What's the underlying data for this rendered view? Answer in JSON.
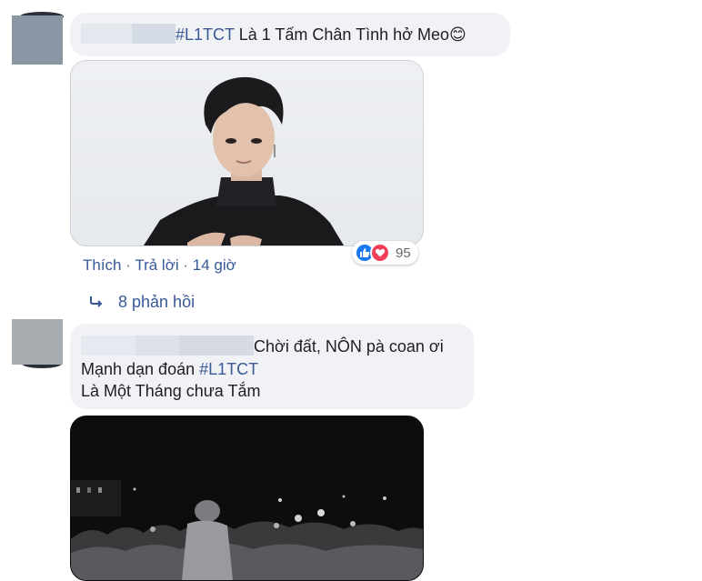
{
  "comment1": {
    "hashtag": "#L1TCT",
    "text": " Là 1 Tấm Chân Tình hở Meo",
    "emoji": "😊",
    "actions": {
      "like": "Thích",
      "reply": "Trả lời",
      "time": "14 giờ",
      "sep": " · "
    },
    "reaction_count": "95",
    "reaction_icons": [
      "like-icon",
      "love-icon"
    ],
    "replies_label": "8 phản hồi"
  },
  "comment2": {
    "line1": "Chời đất, NÔN pà coan ơi",
    "line2_prefix": "Mạnh dạn đoán ",
    "line2_hashtag": "#L1TCT",
    "line3": "Là Một Tháng chưa Tắm"
  },
  "colors": {
    "link": "#385898",
    "bubble": "#f0f2f5",
    "like": "#1877f2",
    "love": "#f33e58"
  }
}
